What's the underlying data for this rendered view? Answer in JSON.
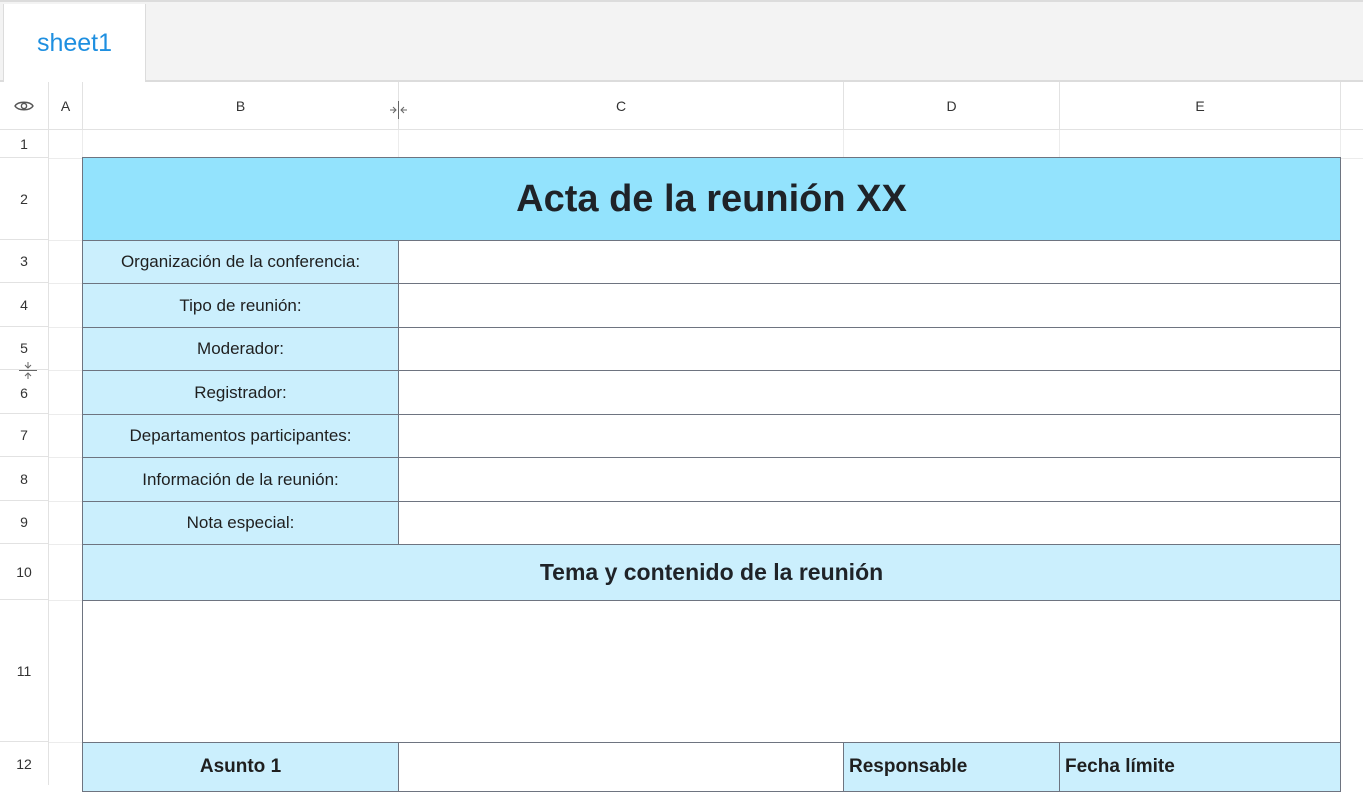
{
  "sheet_tabs": [
    {
      "label": "sheet1",
      "active": true
    }
  ],
  "accent_color": "#1e8fe0",
  "label_fill": "#cbeffd",
  "title_fill": "#93e3fd",
  "columns": [
    "A",
    "B",
    "C",
    "D",
    "E"
  ],
  "rows": [
    "1",
    "2",
    "3",
    "4",
    "5",
    "6",
    "7",
    "8",
    "9",
    "10",
    "11",
    "12"
  ],
  "icons": {
    "corner": "eye-icon",
    "column_resize": "column-resize-icon",
    "row_resize": "row-resize-icon"
  },
  "content": {
    "title": "Acta de la reunión XX",
    "fields": [
      {
        "label": "Organización de la conferencia:",
        "value": ""
      },
      {
        "label": "Tipo de reunión:",
        "value": ""
      },
      {
        "label": "Moderador:",
        "value": ""
      },
      {
        "label": "Registrador:",
        "value": ""
      },
      {
        "label": "Departamentos participantes:",
        "value": ""
      },
      {
        "label": "Información de la reunión:",
        "value": ""
      },
      {
        "label": "Nota especial:",
        "value": ""
      }
    ],
    "section_title": "Tema y contenido de la reunión",
    "topic_content": "",
    "issue_row": {
      "issue": "Asunto 1",
      "description": "",
      "responsible": "Responsable",
      "deadline": "Fecha límite"
    }
  }
}
